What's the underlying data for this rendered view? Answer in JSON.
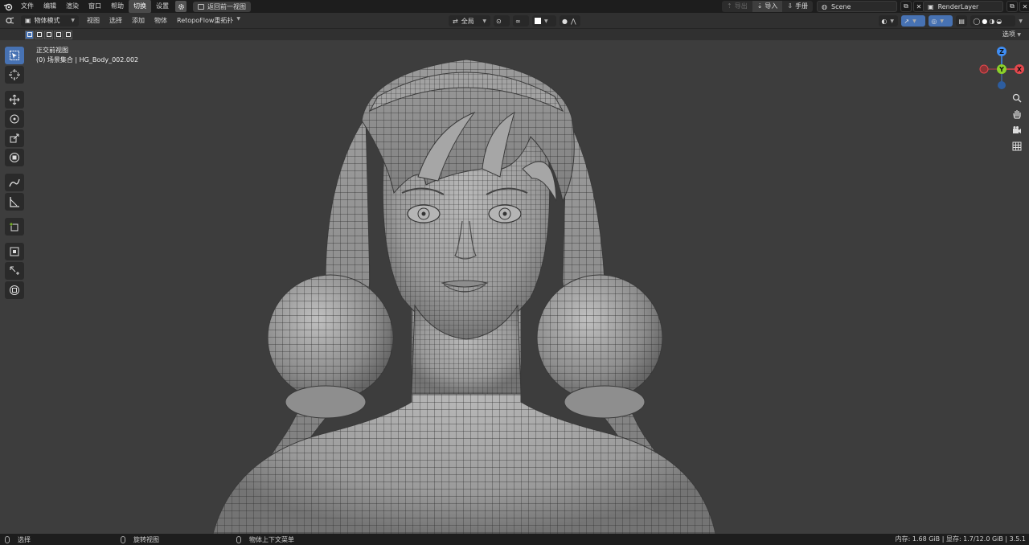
{
  "topbar": {
    "menus": [
      "文件",
      "编辑",
      "渲染",
      "窗口",
      "帮助",
      "切换",
      "设置"
    ],
    "active_menu": "切换",
    "back_button": "返回前一视图",
    "export": "导出",
    "import": "导入",
    "manual": "手册",
    "scene_name": "Scene",
    "render_layer": "RenderLayer"
  },
  "header": {
    "mode": "物体模式",
    "menus": [
      "视图",
      "选择",
      "添加",
      "物体"
    ],
    "addon_menu": "RetopoFlow重拓扑",
    "transform_orientation": "全局",
    "options": "选项"
  },
  "viewport": {
    "view_name": "正交前视图",
    "collection_info": "(0) 场景集合 | HG_Body_002.002"
  },
  "gizmo": {
    "z_label": "Z",
    "y_label": "Y",
    "x_label": "X",
    "colors": {
      "x": "#e5484d",
      "y": "#8bd12a",
      "z": "#3f8ef5"
    }
  },
  "toolbar": {
    "tools": [
      "select-box",
      "cursor",
      "move",
      "rotate",
      "scale",
      "transform",
      "annotate",
      "measure",
      "add-cube",
      "retopo-select",
      "retopo-draw",
      "retopo-object"
    ]
  },
  "statusbar": {
    "select": "选择",
    "rotate_view": "旋转视图",
    "context_menu": "物体上下文菜单",
    "stats": "内存: 1.68 GiB | 显存: 1.7/12.0 GiB | 3.5.1"
  }
}
